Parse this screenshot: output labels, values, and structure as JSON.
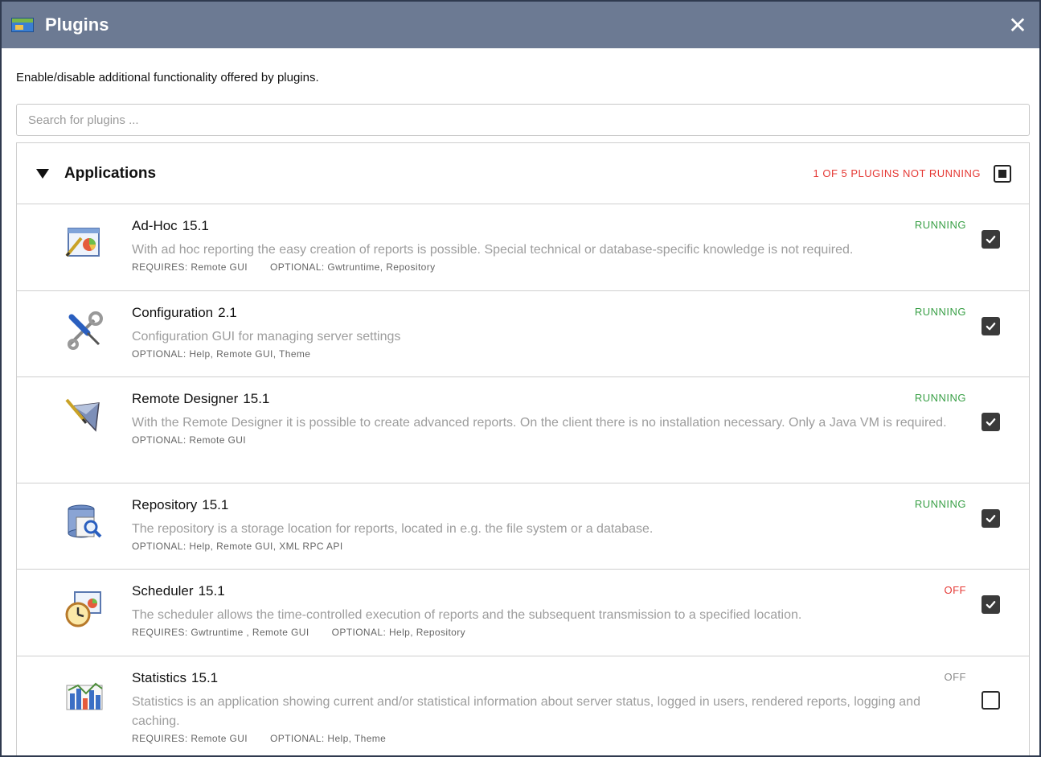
{
  "window": {
    "title": "Plugins",
    "close_glyph": "✕"
  },
  "description": "Enable/disable additional functionality offered by plugins.",
  "search": {
    "placeholder": "Search for plugins ...",
    "value": ""
  },
  "group": {
    "title": "Applications",
    "status": "1 OF 5 PLUGINS NOT RUNNING",
    "status_color": "#e53935",
    "toggle_state": "partial"
  },
  "plugins": [
    {
      "name": "Ad-Hoc",
      "version": "15.1",
      "icon": "adhoc-report-icon",
      "status": "RUNNING",
      "enabled": true,
      "description": "With ad hoc reporting the easy creation of reports is possible. Special technical or database-specific knowledge is not required.",
      "requires": "REQUIRES: Remote GUI",
      "optional": "OPTIONAL: Gwtruntime, Repository"
    },
    {
      "name": "Configuration",
      "version": "2.1",
      "icon": "wrench-screwdriver-icon",
      "status": "RUNNING",
      "enabled": true,
      "description": "Configuration GUI for managing server settings",
      "requires": "",
      "optional": "OPTIONAL: Help, Remote GUI, Theme"
    },
    {
      "name": "Remote Designer",
      "version": "15.1",
      "icon": "remote-designer-icon",
      "status": "RUNNING",
      "enabled": true,
      "description": "With the Remote Designer it is possible to create advanced reports. On the client there is no installation necessary. Only a Java VM is required.",
      "requires": "",
      "optional": "OPTIONAL: Remote GUI"
    },
    {
      "name": "Repository",
      "version": "15.1",
      "icon": "repository-icon",
      "status": "RUNNING",
      "enabled": true,
      "description": "The repository is a storage location for reports, located in e.g. the file system or a database.",
      "requires": "",
      "optional": "OPTIONAL: Help, Remote GUI, XML RPC API"
    },
    {
      "name": "Scheduler",
      "version": "15.1",
      "icon": "scheduler-clock-icon",
      "status": "OFF",
      "enabled": true,
      "description": "The scheduler allows the time-controlled execution of reports and the subsequent transmission to a specified location.",
      "requires": "REQUIRES: Gwtruntime , Remote GUI",
      "optional": "OPTIONAL: Help, Repository"
    },
    {
      "name": "Statistics",
      "version": "15.1",
      "icon": "statistics-chart-icon",
      "status": "OFF",
      "enabled": false,
      "description": "Statistics is an application showing current and/or statistical information about server status, logged in users, rendered reports, logging and caching.",
      "requires": "REQUIRES: Remote GUI",
      "optional": "OPTIONAL: Help, Theme"
    }
  ],
  "colors": {
    "titlebar": "#6c7a93",
    "running": "#3aa047",
    "off_active": "#e53935",
    "off_inactive": "#8a8a8a"
  }
}
